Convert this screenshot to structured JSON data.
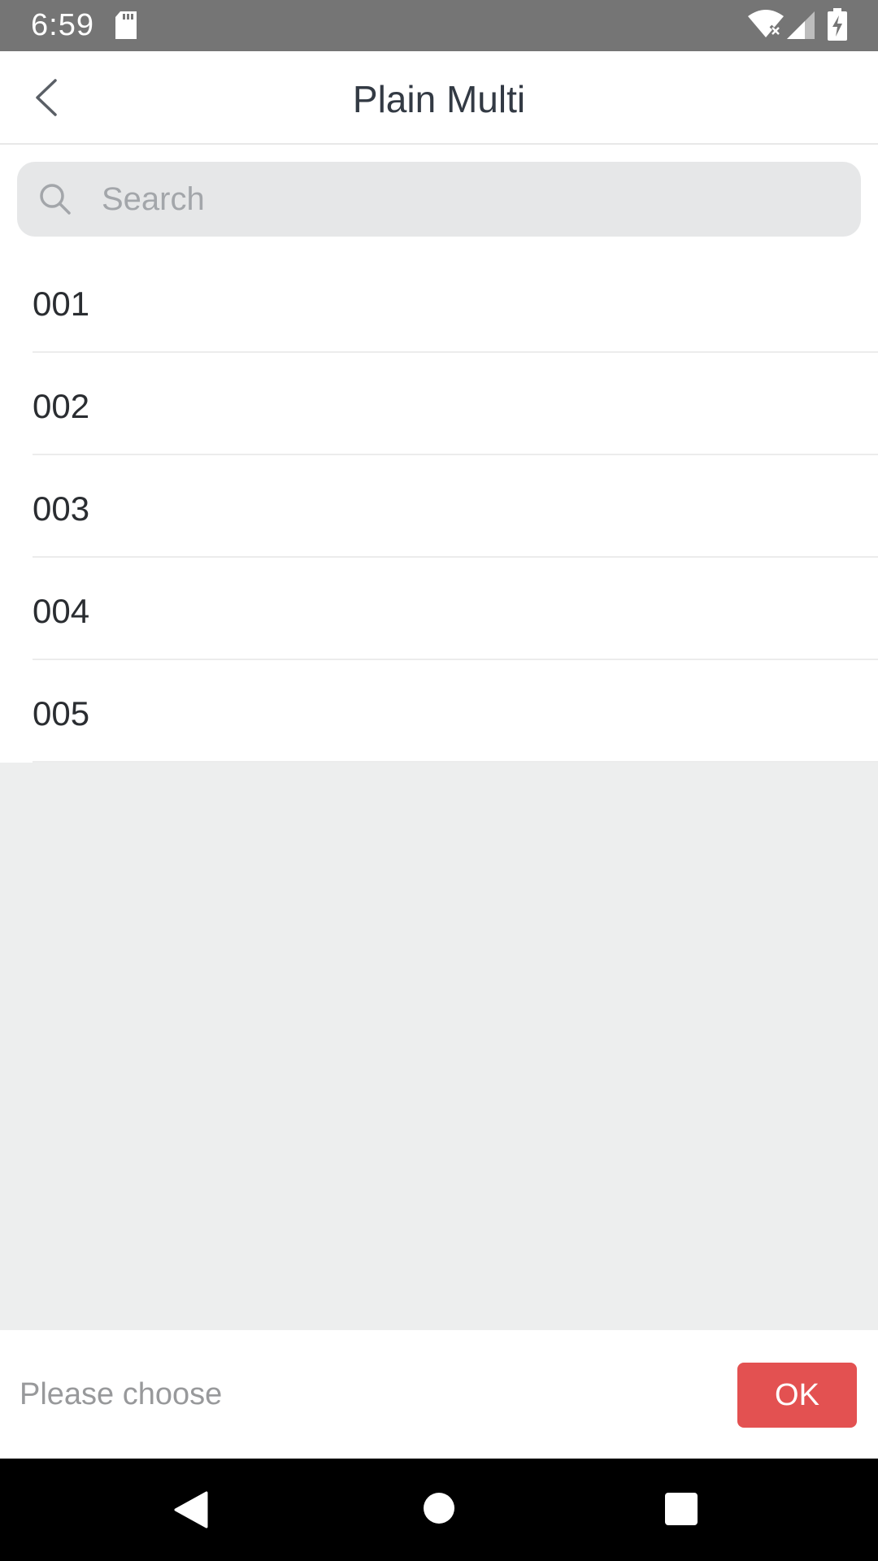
{
  "status_bar": {
    "time": "6:59",
    "icons": [
      "sd-card-icon",
      "wifi-off-icon",
      "signal-icon",
      "battery-charging-icon"
    ]
  },
  "header": {
    "title": "Plain Multi",
    "back_icon": "chevron-left-icon"
  },
  "search": {
    "placeholder": "Search",
    "value": "",
    "icon": "search-icon"
  },
  "list": {
    "items": [
      {
        "label": "001"
      },
      {
        "label": "002"
      },
      {
        "label": "003"
      },
      {
        "label": "004"
      },
      {
        "label": "005"
      }
    ]
  },
  "footer": {
    "hint": "Please choose",
    "ok_label": "OK"
  },
  "nav_bar": {
    "icons": [
      "back-triangle-icon",
      "home-circle-icon",
      "recents-square-icon"
    ]
  },
  "colors": {
    "accent": "#e35151",
    "status_bar": "#757575",
    "background": "#edeeee",
    "title_text": "#333a44"
  }
}
